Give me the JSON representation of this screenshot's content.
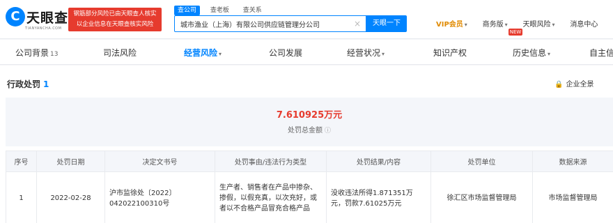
{
  "header": {
    "logo_mark": "C",
    "logo_text": "天眼查",
    "logo_sub": "TIANYANCHA.COM",
    "promo_line1": "钢筋部分风险已由天眼查人核实",
    "promo_line2": "以企业信息在天眼查核实风险",
    "search_tabs": [
      "查公司",
      "查老板",
      "查关系"
    ],
    "search_value": "城市渔业（上海）有限公司供应链管理分公司",
    "search_button": "天眼一下",
    "nav": {
      "vip": "VIP会员",
      "tools": "商务版",
      "tools_badge": "NEW",
      "apps": "天眼风险",
      "user": "消息中心"
    }
  },
  "section_tabs": {
    "overview": "公司背景",
    "overview_count": "13",
    "judicial": "司法风险",
    "operating_risk": "经营风险",
    "development": "公司发展",
    "operating_status": "经营状况",
    "ip": "知识产权",
    "history": "历史信息",
    "self_info": "自主信息"
  },
  "content": {
    "section_title": "行政处罚",
    "section_count": "1",
    "export_label": "企业全景",
    "stat_value": "7.610925万元",
    "stat_label": "处罚总金额",
    "stat_info_icon": "ⓘ",
    "table": {
      "headers": [
        "序号",
        "处罚日期",
        "决定文书号",
        "处罚事由/违法行为类型",
        "处罚结果/内容",
        "处罚单位",
        "数据来源"
      ],
      "rows": [
        {
          "index": "1",
          "date": "2022-02-28",
          "doc_no": "沪市监徐处〔2022〕042022100310号",
          "reason": "生产者、销售者在产品中掺杂、掺假，以假充真，以次充好，或者以不合格产品冒充合格产品",
          "result": "没收违法所得1.871351万元，罚款7.61025万元",
          "authority": "徐汇区市场监督管理局",
          "source": "市场监督管理局"
        }
      ]
    }
  }
}
